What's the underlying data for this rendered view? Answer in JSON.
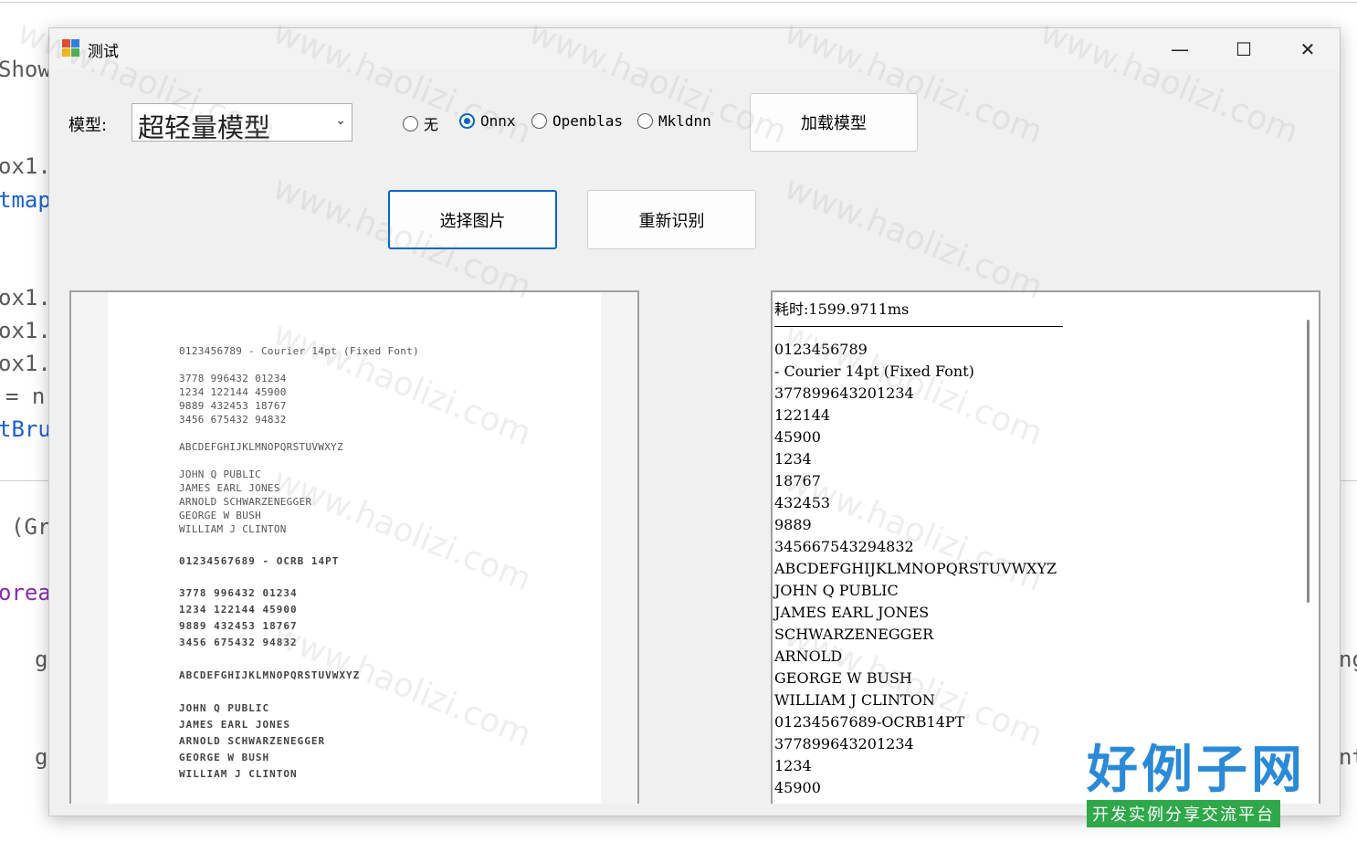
{
  "window": {
    "title": "测试",
    "controls": {
      "minimize": "—",
      "maximize": "☐",
      "close": "✕"
    }
  },
  "model_label": "模型:",
  "model_select": {
    "value": "超轻量模型"
  },
  "engines": [
    {
      "label": "无",
      "selected": false
    },
    {
      "label": "Onnx",
      "selected": true
    },
    {
      "label": "Openblas",
      "selected": false
    },
    {
      "label": "Mkldnn",
      "selected": false
    }
  ],
  "buttons": {
    "load_model": "加载模型",
    "select_image": "选择图片",
    "re_recognize": "重新识别"
  },
  "image_doc": {
    "lines": [
      "0123456789  - Courier 14pt (Fixed Font)",
      "3778 996432 01234",
      "1234 122144 45900",
      "9889 432453 18767",
      "3456 675432 94832",
      "ABCDEFGHIJKLMNOPQRSTUVWXYZ",
      "JOHN Q PUBLIC",
      "JAMES EARL JONES",
      "ARNOLD SCHWARZENEGGER",
      "GEORGE W BUSH",
      "WILLIAM J CLINTON",
      "01234567689 - OCRB 14PT",
      "3778 996432 01234",
      "1234 122144 45900",
      "9889 432453 18767",
      "3456 675432 94832",
      "ABCDEFGHIJKLMNOPQRSTUVWXYZ",
      "JOHN Q PUBLIC",
      "JAMES EARL JONES",
      "ARNOLD SCHWARZENEGGER",
      "GEORGE W BUSH",
      "WILLIAM J CLINTON"
    ]
  },
  "result": {
    "elapsed": "耗时:1599.9711ms",
    "lines": [
      "0123456789",
      "- Courier 14pt (Fixed Font)",
      "377899643201234",
      "122144",
      "45900",
      "1234",
      "18767",
      "432453",
      "9889",
      "345667543294832",
      "ABCDEFGHIJKLMNOPQRSTUVWXYZ",
      "JOHN Q PUBLIC",
      "JAMES EARL JONES",
      "SCHWARZENEGGER",
      "ARNOLD",
      "GEORGE W BUSH",
      "WILLIAM J CLINTON",
      "01234567689-OCRB14PT",
      "377899643201234",
      "1234",
      "45900"
    ]
  },
  "background_code": {
    "lines": [
      "Show",
      "ox1.",
      "tmap",
      "ox1.",
      "ox1.",
      "ox1.",
      "= n",
      "tBru",
      "(Gr",
      "orea",
      "g",
      "g"
    ],
    "right": [
      "ng",
      "nt"
    ]
  },
  "watermark": {
    "text": "www.haolizi.com",
    "brand": "好例子网",
    "slogan": "开发实例分享交流平台"
  }
}
